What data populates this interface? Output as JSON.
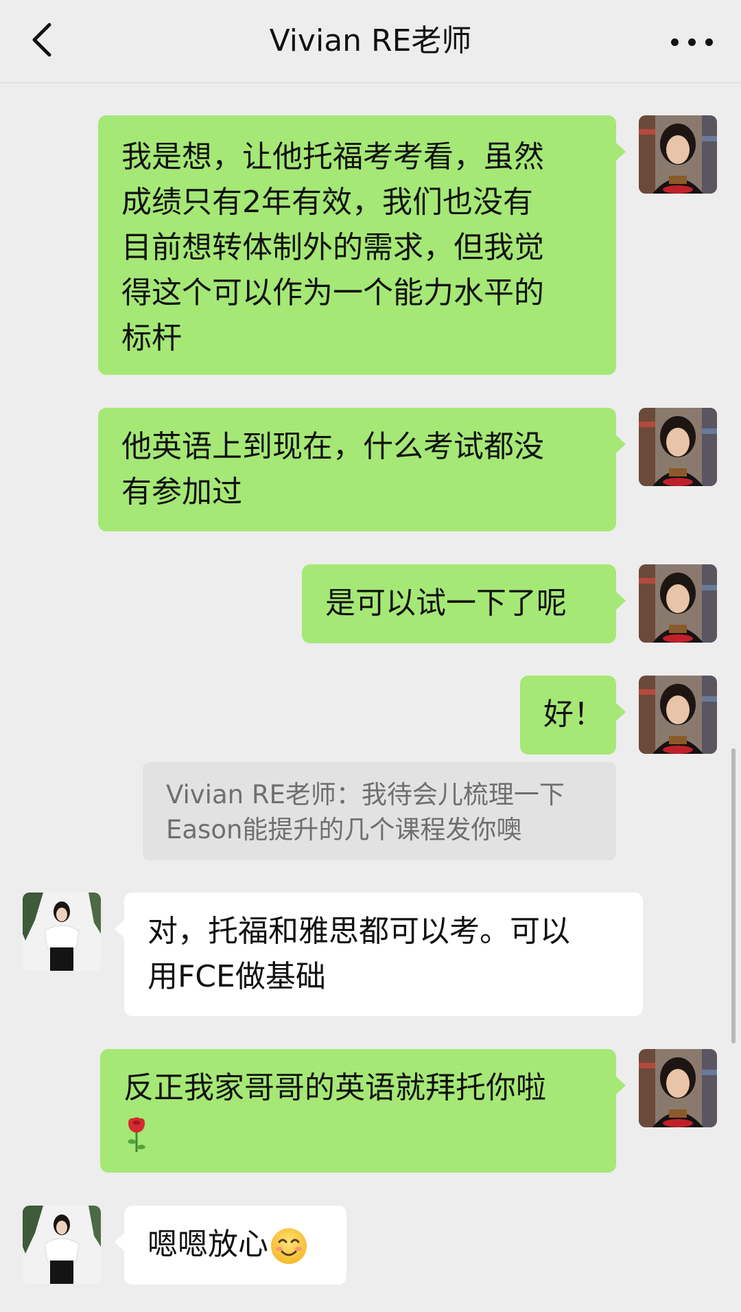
{
  "header": {
    "title": "Vivian RE老师"
  },
  "messages": [
    {
      "side": "out",
      "lines": [
        "我是想，让他托福考考看，虽然",
        "成绩只有2年有效，我们也没有",
        "目前想转体制外的需求，但我觉",
        "得这个可以作为一个能力水平的",
        "标杆"
      ]
    },
    {
      "side": "out",
      "lines": [
        "他英语上到现在，什么考试都没",
        "有参加过"
      ]
    },
    {
      "side": "out",
      "lines": [
        "是可以试一下了呢"
      ]
    },
    {
      "side": "out",
      "lines": [
        "好！"
      ]
    },
    {
      "side": "quote",
      "lines": [
        "Vivian RE老师：我待会儿梳理一下",
        "Eason能提升的几个课程发你噢"
      ]
    },
    {
      "side": "in",
      "lines": [
        "对，托福和雅思都可以考。可以",
        "用FCE做基础"
      ]
    },
    {
      "side": "out",
      "lines": [
        "反正我家哥哥的英语就拜托你啦"
      ],
      "emoji": "rose-emoji"
    },
    {
      "side": "in",
      "lines": [
        "嗯嗯放心"
      ],
      "emoji": "smiling-face-emoji"
    }
  ],
  "colors": {
    "background": "#ededed",
    "outgoing_bubble": "#a5e876",
    "incoming_bubble": "#ffffff",
    "quote_bubble": "#e2e2e2"
  }
}
